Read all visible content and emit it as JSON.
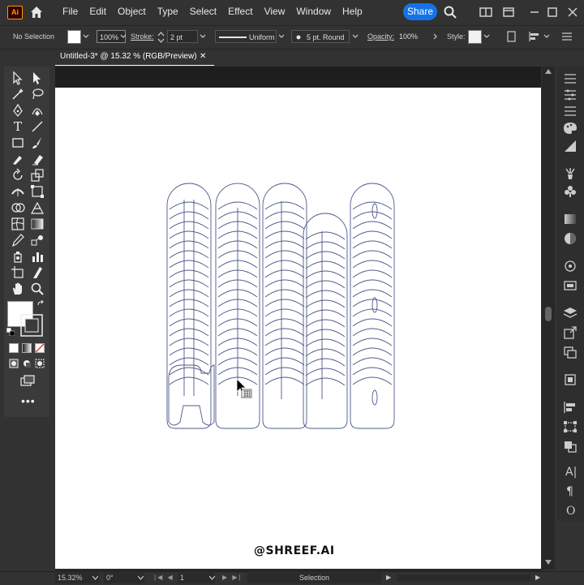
{
  "app": {
    "logo_text": "Ai",
    "brand_color": "#ff9a00"
  },
  "menu": {
    "items": [
      "File",
      "Edit",
      "Object",
      "Type",
      "Select",
      "Effect",
      "View",
      "Window",
      "Help"
    ]
  },
  "header": {
    "share_label": "Share",
    "share_color": "#1473e6"
  },
  "control": {
    "selection_label": "No Selection",
    "fill_opacity": "100%",
    "stroke_label": "Stroke:",
    "stroke_weight": "2 pt",
    "stroke_profile": "Uniform",
    "brush": "5 pt. Round",
    "opacity_label": "Opacity:",
    "opacity_value": "100%",
    "style_label": "Style:"
  },
  "document": {
    "tab_title": "Untitled-3* @ 15.32 % (RGB/Preview)",
    "close_glyph": "✕"
  },
  "status": {
    "zoom": "15.32%",
    "rotation": "0°",
    "artboard": "1",
    "tool": "Selection"
  },
  "artwork": {
    "text": "HELLO",
    "stroke_color": "#4a5a8a"
  },
  "watermark": {
    "text": "@SHREEF.AI"
  }
}
